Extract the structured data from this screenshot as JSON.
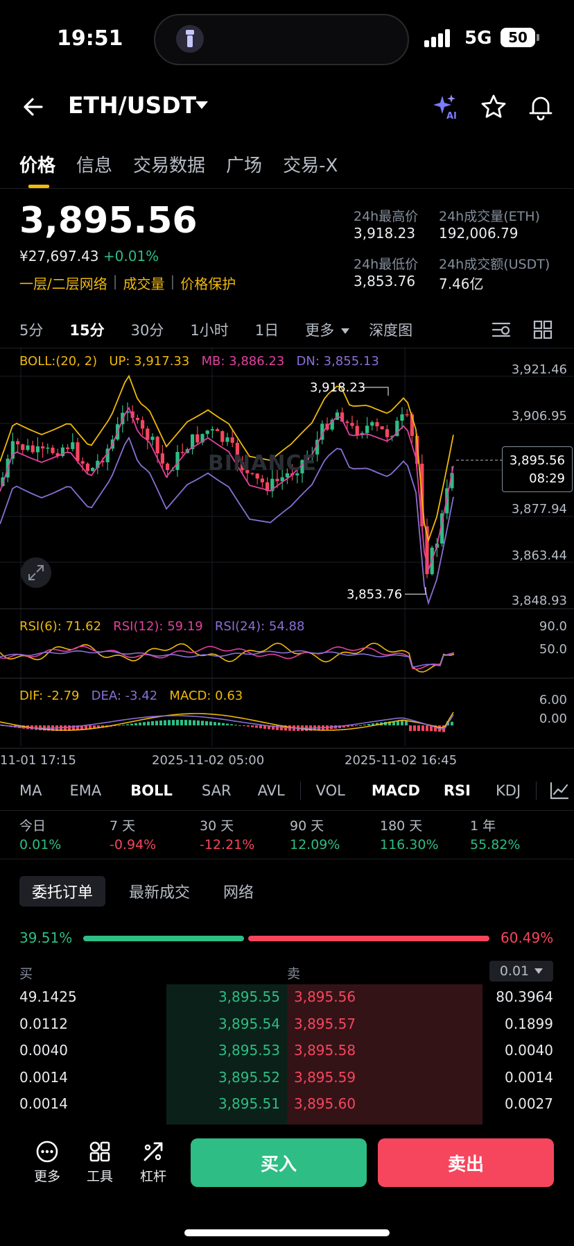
{
  "status_bar": {
    "time": "19:51",
    "network": "5G",
    "battery": "50"
  },
  "header": {
    "pair": "ETH/USDT",
    "icons": [
      "back-arrow-icon",
      "ai-sparkle-icon",
      "star-icon",
      "bell-icon"
    ]
  },
  "tabs": [
    {
      "label": "价格",
      "active": true
    },
    {
      "label": "信息"
    },
    {
      "label": "交易数据"
    },
    {
      "label": "广场"
    },
    {
      "label": "交易-X"
    }
  ],
  "ticker": {
    "price": "3,895.56",
    "cny": "¥27,697.43",
    "change": "+0.01%",
    "links": [
      "一层/二层网络",
      "成交量",
      "价格保护"
    ],
    "high_label": "24h最高价",
    "high": "3,918.23",
    "low_label": "24h最低价",
    "low": "3,853.76",
    "vol_label": "24h成交量(ETH)",
    "vol": "192,006.79",
    "amt_label": "24h成交额(USDT)",
    "amt": "7.46亿"
  },
  "intervals": {
    "items": [
      "5分",
      "15分",
      "30分",
      "1小时",
      "1日"
    ],
    "active": "15分",
    "more": "更多",
    "depth": "深度图"
  },
  "chart": {
    "boll_legend": "BOLL:(20, 2)",
    "up": "UP: 3,917.33",
    "mb": "MB: 3,886.23",
    "dn": "DN: 3,855.13",
    "y_ticks": [
      "3,921.46",
      "3,906.95",
      "3,877.94",
      "3,863.44",
      "3,848.93"
    ],
    "high_marker": "3,918.23",
    "low_marker": "3,853.76",
    "last_price": "3,895.56",
    "countdown": "08:29",
    "watermark": "BINANCE",
    "rsi6": "RSI(6): 71.62",
    "rsi12": "RSI(12): 59.19",
    "rsi24": "RSI(24): 54.88",
    "rsi_ticks": [
      "90.0",
      "50.0"
    ],
    "dif": "DIF: -2.79",
    "dea": "DEA: -3.42",
    "macd": "MACD: 0.63",
    "macd_ticks": [
      "6.00",
      "0.00"
    ],
    "x_labels": [
      "11-01 17:15",
      "2025-11-02 05:00",
      "2025-11-02 16:45"
    ],
    "colors": {
      "boll_up": "#f0b90b",
      "boll_mb": "#e040a0",
      "boll_dn": "#8a6fd6",
      "rise": "#2ebd85",
      "fall": "#f6465d"
    }
  },
  "indicators": {
    "main": [
      "MA",
      "EMA",
      "BOLL",
      "SAR",
      "AVL"
    ],
    "sub": [
      "VOL",
      "MACD",
      "RSI",
      "KDJ"
    ],
    "active": [
      "BOLL",
      "MACD",
      "RSI"
    ]
  },
  "performance": [
    {
      "label": "今日",
      "value": "0.01%",
      "dir": "up"
    },
    {
      "label": "7 天",
      "value": "-0.94%",
      "dir": "down"
    },
    {
      "label": "30 天",
      "value": "-12.21%",
      "dir": "down"
    },
    {
      "label": "90 天",
      "value": "12.09%",
      "dir": "up"
    },
    {
      "label": "180 天",
      "value": "116.30%",
      "dir": "up"
    },
    {
      "label": "1 年",
      "value": "55.82%",
      "dir": "up"
    }
  ],
  "orderbook": {
    "tabs": [
      "委托订单",
      "最新成交",
      "网络"
    ],
    "buy_ratio": "39.51%",
    "sell_ratio": "60.49%",
    "buy_ratio_value": 39.51,
    "buy_label": "买",
    "sell_label": "卖",
    "precision": "0.01",
    "rows": [
      {
        "bid_qty": "49.1425",
        "bid": "3,895.55",
        "ask": "3,895.56",
        "ask_qty": "80.3964"
      },
      {
        "bid_qty": "0.0112",
        "bid": "3,895.54",
        "ask": "3,895.57",
        "ask_qty": "0.1899"
      },
      {
        "bid_qty": "0.0040",
        "bid": "3,895.53",
        "ask": "3,895.58",
        "ask_qty": "0.0040"
      },
      {
        "bid_qty": "0.0014",
        "bid": "3,895.52",
        "ask": "3,895.59",
        "ask_qty": "0.0014"
      },
      {
        "bid_qty": "0.0014",
        "bid": "3,895.51",
        "ask": "3,895.60",
        "ask_qty": "0.0027"
      }
    ]
  },
  "bottom_bar": {
    "more": "更多",
    "tools": "工具",
    "leverage": "杠杆",
    "buy": "买入",
    "sell": "卖出"
  }
}
